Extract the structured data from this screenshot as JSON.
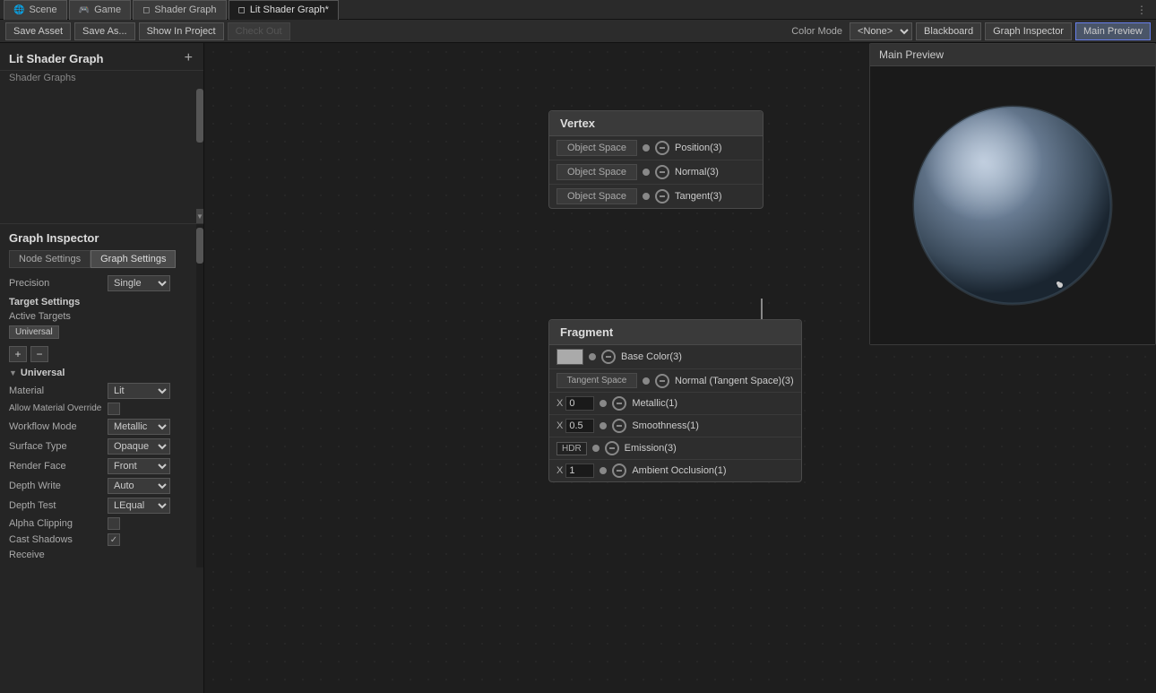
{
  "tabs": [
    {
      "label": "Scene",
      "icon": "🌐",
      "active": false
    },
    {
      "label": "Game",
      "icon": "🎮",
      "active": false
    },
    {
      "label": "Shader Graph",
      "icon": "◻",
      "active": false
    },
    {
      "label": "Lit Shader Graph*",
      "icon": "◻",
      "active": true
    }
  ],
  "toolbar": {
    "save_asset": "Save Asset",
    "save_as": "Save As...",
    "show_in_project": "Show In Project",
    "check_out": "Check Out",
    "color_mode_label": "Color Mode",
    "color_mode_value": "<None>",
    "blackboard": "Blackboard",
    "graph_inspector": "Graph Inspector",
    "main_preview": "Main Preview"
  },
  "left_panel": {
    "title": "Lit Shader Graph",
    "sub_label": "Shader Graphs",
    "add_btn": "+"
  },
  "graph_inspector": {
    "title": "Graph Inspector",
    "tabs": [
      "Node Settings",
      "Graph Settings"
    ],
    "active_tab": "Graph Settings",
    "precision_label": "Precision",
    "precision_value": "Single",
    "target_settings_label": "Target Settings",
    "active_targets_label": "Active Targets",
    "universal_chip": "Universal",
    "add_btn": "+",
    "remove_btn": "−",
    "universal_section": "Universal",
    "material_label": "Material",
    "material_value": "Lit",
    "allow_override_label": "Allow Material Override",
    "workflow_label": "Workflow Mode",
    "workflow_value": "Metallic",
    "surface_label": "Surface Type",
    "surface_value": "Opaque",
    "render_face_label": "Render Face",
    "render_face_value": "Front",
    "depth_write_label": "Depth Write",
    "depth_write_value": "Auto",
    "depth_test_label": "Depth Test",
    "depth_test_value": "LEqual",
    "alpha_clipping_label": "Alpha Clipping",
    "cast_shadows_label": "Cast Shadows",
    "cast_shadows_checked": true,
    "receive_label": "Receive"
  },
  "vertex_node": {
    "title": "Vertex",
    "ports": [
      {
        "label": "Object Space",
        "name": "Position(3)"
      },
      {
        "label": "Object Space",
        "name": "Normal(3)"
      },
      {
        "label": "Object Space",
        "name": "Tangent(3)"
      }
    ]
  },
  "fragment_node": {
    "title": "Fragment",
    "ports": [
      {
        "input": "color_swatch",
        "name": "Base Color(3)"
      },
      {
        "input": "tangent_space",
        "name": "Normal (Tangent Space)(3)"
      },
      {
        "input": "x_0",
        "name": "Metallic(1)"
      },
      {
        "input": "x_0.5",
        "name": "Smoothness(1)"
      },
      {
        "input": "hdr",
        "name": "Emission(3)"
      },
      {
        "input": "x_1",
        "name": "Ambient Occlusion(1)"
      }
    ]
  },
  "preview": {
    "title": "Main Preview"
  }
}
